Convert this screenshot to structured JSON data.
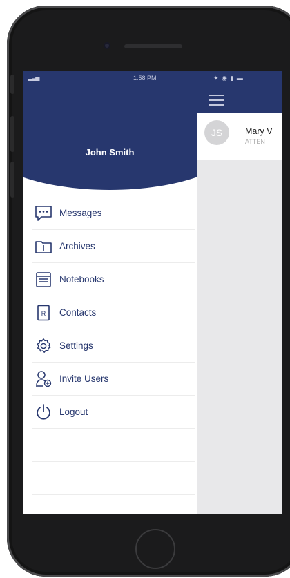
{
  "statusbar": {
    "time": "1:58 PM"
  },
  "drawer": {
    "user_name": "John Smith",
    "menu": [
      {
        "label": "Messages",
        "icon": "messages-icon"
      },
      {
        "label": "Archives",
        "icon": "archive-icon"
      },
      {
        "label": "Notebooks",
        "icon": "notebook-icon"
      },
      {
        "label": "Contacts",
        "icon": "contacts-icon"
      },
      {
        "label": "Settings",
        "icon": "gear-icon"
      },
      {
        "label": "Invite Users",
        "icon": "invite-user-icon"
      },
      {
        "label": "Logout",
        "icon": "power-icon"
      }
    ]
  },
  "main": {
    "conversation": {
      "avatar_initials": "JS",
      "name": "Mary V",
      "subtitle": "ATTEN"
    }
  },
  "colors": {
    "brand": "#27376e",
    "drawer_bg": "#ffffff",
    "content_bg": "#e8e8ea"
  }
}
